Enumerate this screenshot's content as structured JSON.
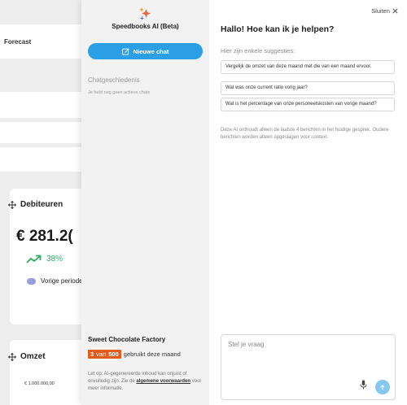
{
  "background": {
    "forecast_label": "Forecast",
    "debiteuren_card": {
      "title": "Debiteuren",
      "amount": "€ 281.2(",
      "trend_percent": "38%",
      "legend_label": "Vorige periode",
      "legend_color": "#9a9ed6"
    },
    "omzet_card": {
      "title": "Omzet",
      "axis_tick": "€ 1.000.000,00"
    }
  },
  "sidebar": {
    "app_title": "Speedbooks AI (Beta)",
    "new_chat_label": "Nieuwe chat",
    "history_title": "Chatgeschiedenis",
    "history_empty": "Je hebt nog geen actieve chats",
    "company_name": "Sweet Chocolate Factory",
    "usage": {
      "used": "3",
      "of_label": "van",
      "total": "500",
      "suffix": "gebruikt deze maand"
    },
    "disclaimer": {
      "prefix": "Let op: AI-gegenereerde inhoud kan onjuist of onvolledig zijn. Zie de",
      "link": "algemene voorwaarden",
      "suffix": "voor meer informatie."
    }
  },
  "panel": {
    "close_label": "Sluiten",
    "greeting": "Hallo! Hoe kan ik je helpen?",
    "suggestions_title": "Hier zijn enkele suggesties:",
    "suggestions": [
      "Vergelijk de omzet van deze maand met die van een maand ervoor.",
      "Wat was onze current ratio vorig jaar?",
      "Wat is het percentage van onze personeelskosten van vorige maand?"
    ],
    "memory_note": "Deze AI onthoudt alleen de laatste 4 berichten in het huidige gesprek. Oudere berichten worden alleen opgeslagen voor context.",
    "input_placeholder": "Stel je vraag"
  },
  "colors": {
    "accent": "#2b9fe6",
    "usage_badge": "#e25c1d",
    "trend_green": "#27ae60",
    "send_button": "#85c7ee"
  },
  "icons": {
    "logo": "sparkle-icon",
    "new_chat": "edit-icon",
    "close": "close-icon",
    "mic": "microphone-icon",
    "send": "arrow-up-icon",
    "card_handle": "move-icon",
    "trend": "trend-up-icon"
  }
}
